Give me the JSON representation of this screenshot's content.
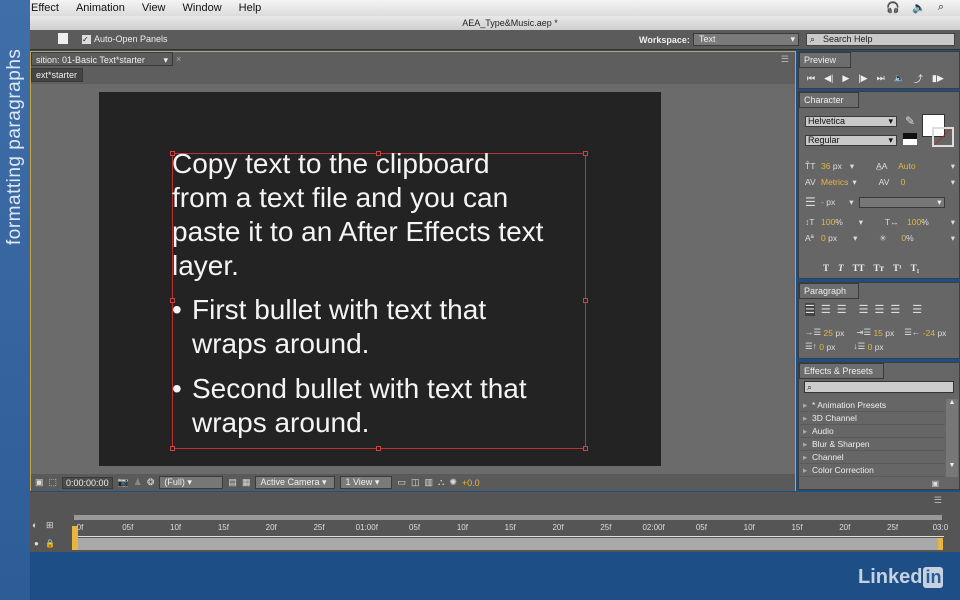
{
  "side_title": "formatting paragraphs",
  "menu": [
    "Effect",
    "Animation",
    "View",
    "Window",
    "Help"
  ],
  "window_title": "AEA_Type&Music.aep *",
  "toolbar": {
    "auto_open": "Auto-Open Panels",
    "workspace_label": "Workspace:",
    "workspace_value": "Text",
    "search_placeholder": "Search Help"
  },
  "comp": {
    "tab": "sition: 01-Basic Text*starter",
    "subtab": "ext*starter",
    "lines": [
      "Copy text to the clipboard",
      "from a text file and you can",
      "paste it to an After Effects text",
      "layer."
    ],
    "bullets": [
      [
        "First bullet with text that",
        "wraps around."
      ],
      [
        "Second bullet with text that",
        "wraps around."
      ]
    ],
    "timecode": "0:00:00:00",
    "resolution": "(Full)",
    "camera": "Active Camera",
    "views": "1 View",
    "exposure": "+0.0"
  },
  "preview": {
    "title": "Preview"
  },
  "character": {
    "title": "Character",
    "font": "Helvetica",
    "style": "Regular",
    "size": "36",
    "size_unit": "px",
    "leading": "Auto",
    "kerning": "Metrics",
    "tracking": "0",
    "stroke": "-",
    "stroke_unit": "px",
    "vscale": "100",
    "vscale_unit": "%",
    "hscale": "100",
    "hscale_unit": "%",
    "baseline": "0",
    "baseline_unit": "px",
    "tsume": "0",
    "tsume_unit": "%",
    "styles": [
      "T",
      "T",
      "TT",
      "Tт",
      "T¹",
      "T₁"
    ]
  },
  "paragraph": {
    "title": "Paragraph",
    "indent_left": "25",
    "indent_first": "15",
    "indent_right": "-24",
    "space_before": "0",
    "space_after": "0",
    "unit": "px"
  },
  "effects": {
    "title": "Effects & Presets",
    "items": [
      "* Animation Presets",
      "3D Channel",
      "Audio",
      "Blur & Sharpen",
      "Channel",
      "Color Correction"
    ]
  },
  "timeline": {
    "ticks": [
      "0f",
      "05f",
      "10f",
      "15f",
      "20f",
      "25f",
      "01:00f",
      "05f",
      "10f",
      "15f",
      "20f",
      "25f",
      "02:00f",
      "05f",
      "10f",
      "15f",
      "20f",
      "25f",
      "03:0"
    ]
  },
  "brand": "Linked",
  "brand_in": "in",
  "colors": {
    "accent": "#e8b540",
    "bounding_box": "#b33333",
    "background": "#1d4f86"
  }
}
